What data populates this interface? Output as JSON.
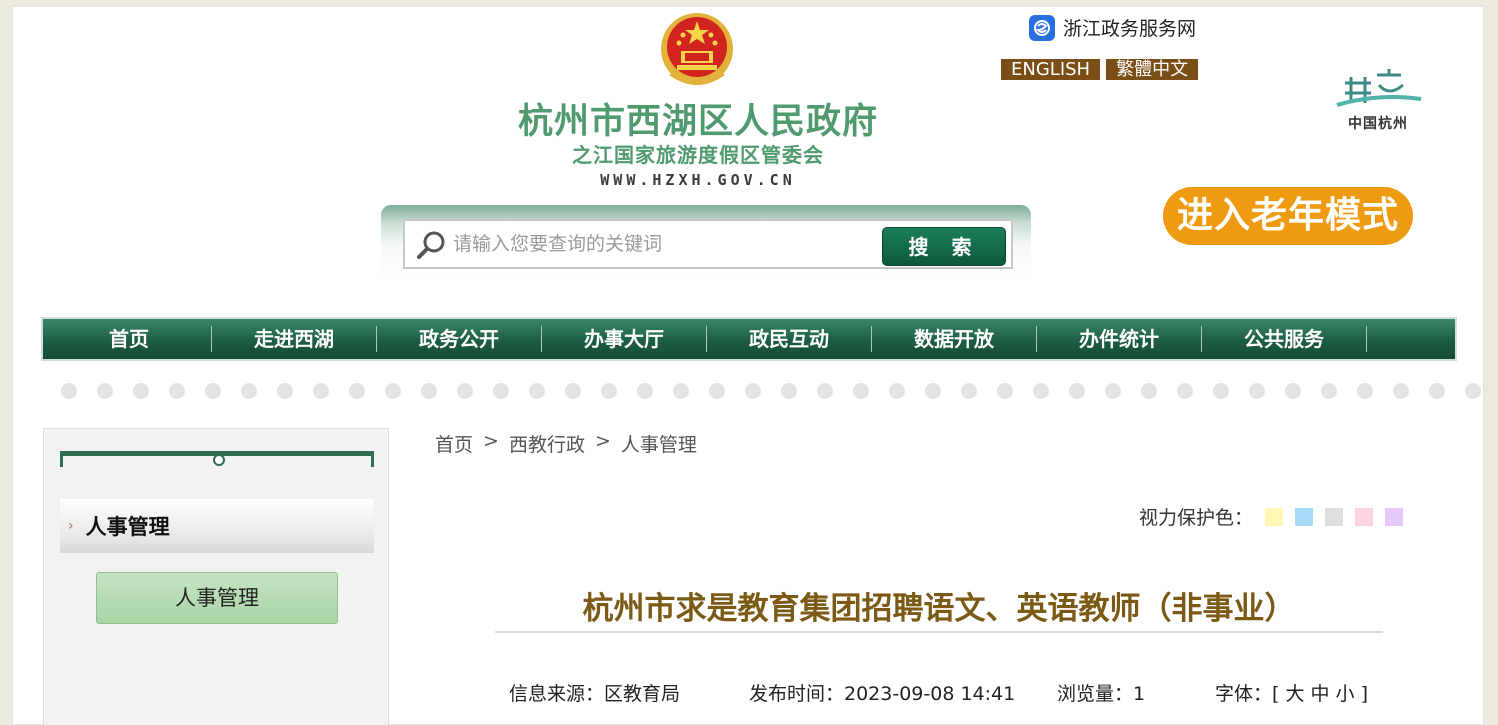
{
  "header": {
    "site_title": "杭州市西湖区人民政府",
    "site_subtitle": "之江国家旅游度假区管委会",
    "site_url": "WWW.HZXH.GOV.CN",
    "zj_link": "浙江政务服务网",
    "lang_english": "ENGLISH",
    "lang_traditional": "繁體中文",
    "hz_logo_text": "中国杭州",
    "elder_mode": "进入老年模式"
  },
  "search": {
    "placeholder": "请输入您要查询的关键词",
    "button": "搜 索"
  },
  "nav": {
    "items": [
      "首页",
      "走进西湖",
      "政务公开",
      "办事大厅",
      "政民互动",
      "数据开放",
      "办件统计",
      "公共服务"
    ]
  },
  "sidebar": {
    "title": "人事管理",
    "sub_item": "人事管理"
  },
  "breadcrumb": {
    "items": [
      "首页",
      "西教行政",
      "人事管理"
    ],
    "separator": ">"
  },
  "vision": {
    "label": "视力保护色：",
    "colors": [
      "#fff7b3",
      "#a5dbf7",
      "#dedede",
      "#fdd3e2",
      "#e6c9fb"
    ]
  },
  "article": {
    "title": "杭州市求是教育集团招聘语文、英语教师（非事业）",
    "source": "信息来源：区教育局",
    "published": "发布时间：2023-09-08 14:41",
    "views": "浏览量：1",
    "font_size": "字体：[ 大 中 小 ]"
  }
}
